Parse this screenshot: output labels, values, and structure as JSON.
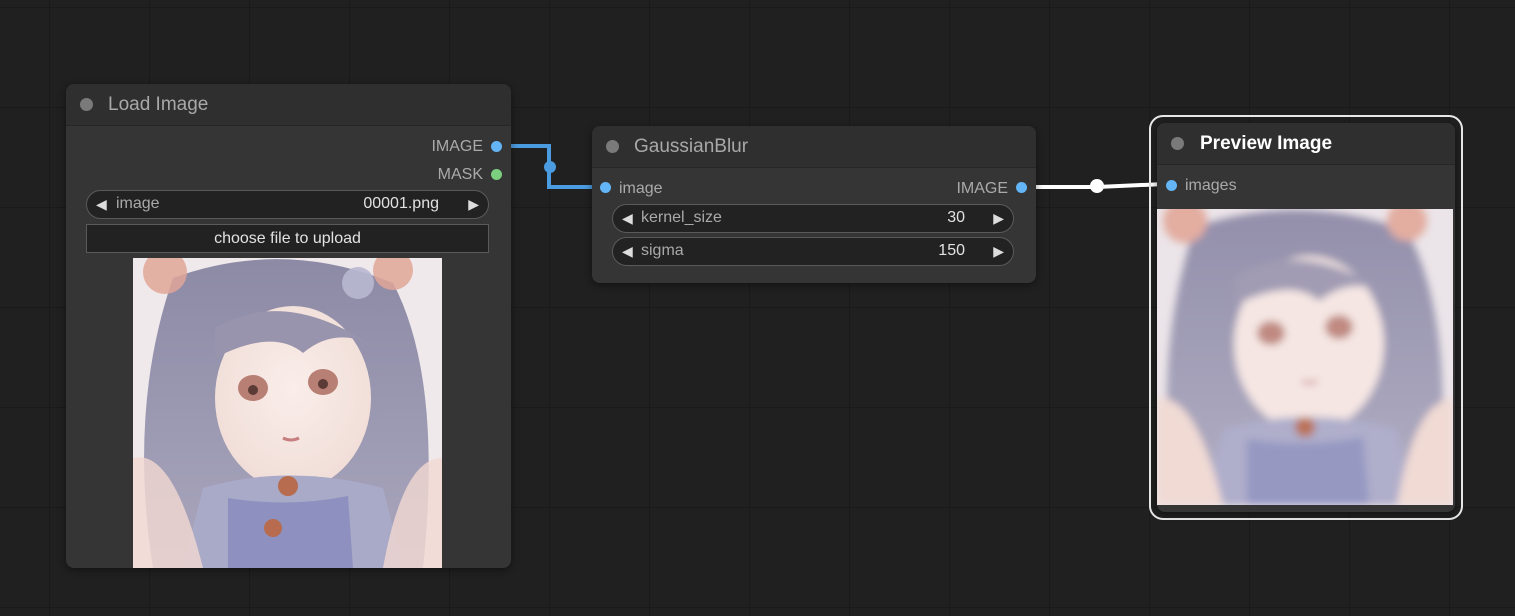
{
  "nodes": {
    "load_image": {
      "title": "Load Image",
      "outputs": [
        {
          "label": "IMAGE",
          "color": "#64b5f6"
        },
        {
          "label": "MASK",
          "color": "#7ccf7f"
        }
      ],
      "widget": {
        "label": "image",
        "value": "00001.png"
      },
      "upload_label": "choose file to upload"
    },
    "gaussian_blur": {
      "title": "GaussianBlur",
      "input": {
        "label": "image"
      },
      "output": {
        "label": "IMAGE"
      },
      "widgets": [
        {
          "label": "kernel_size",
          "value": "30"
        },
        {
          "label": "sigma",
          "value": "150"
        }
      ]
    },
    "preview_image": {
      "title": "Preview Image",
      "selected": true,
      "input": {
        "label": "images"
      }
    }
  },
  "colors": {
    "canvas_bg": "#202020",
    "node_bg": "#353535",
    "link_image": "#4a9be0",
    "selected_link": "#ffffff",
    "slot_image": "#64b5f6",
    "slot_mask": "#7ccf7f"
  },
  "icons": {
    "left_arrow": "◀",
    "right_arrow": "▶"
  }
}
